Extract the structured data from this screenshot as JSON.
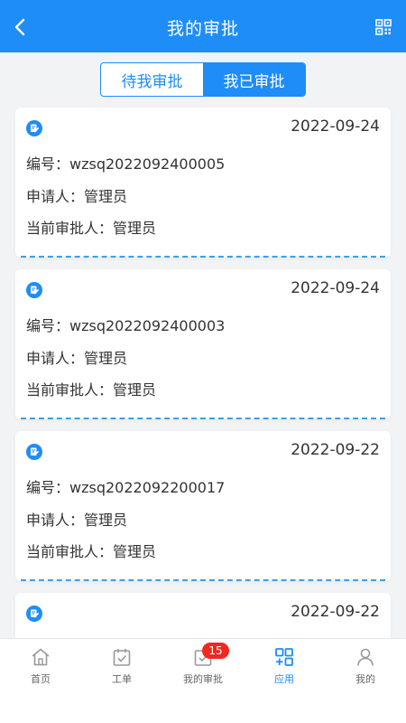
{
  "header": {
    "title": "我的审批"
  },
  "segment": {
    "tabs": [
      "待我审批",
      "我已审批"
    ],
    "active_index": 1
  },
  "records": [
    {
      "date": "2022-09-24",
      "number_line": "编号：wzsq2022092400005",
      "applicant_line": "申请人：管理员",
      "approver_line": "当前审批人：管理员"
    },
    {
      "date": "2022-09-24",
      "number_line": "编号：wzsq2022092400003",
      "applicant_line": "申请人：管理员",
      "approver_line": "当前审批人：管理员"
    },
    {
      "date": "2022-09-22",
      "number_line": "编号：wzsq2022092200017",
      "applicant_line": "申请人：管理员",
      "approver_line": "当前审批人：管理员"
    },
    {
      "date": "2022-09-22"
    }
  ],
  "tabbar": {
    "items": [
      {
        "label": "首页",
        "icon": "home-icon"
      },
      {
        "label": "工单",
        "icon": "calendar-check-icon"
      },
      {
        "label": "我的审批",
        "icon": "approval-icon"
      },
      {
        "label": "应用",
        "icon": "apps-grid-icon"
      },
      {
        "label": "我的",
        "icon": "user-icon"
      }
    ],
    "active_index": 3,
    "badge": "15"
  },
  "colors": {
    "primary": "#1e8df7",
    "badge": "#f0281e",
    "dash": "#3aa0e8"
  }
}
